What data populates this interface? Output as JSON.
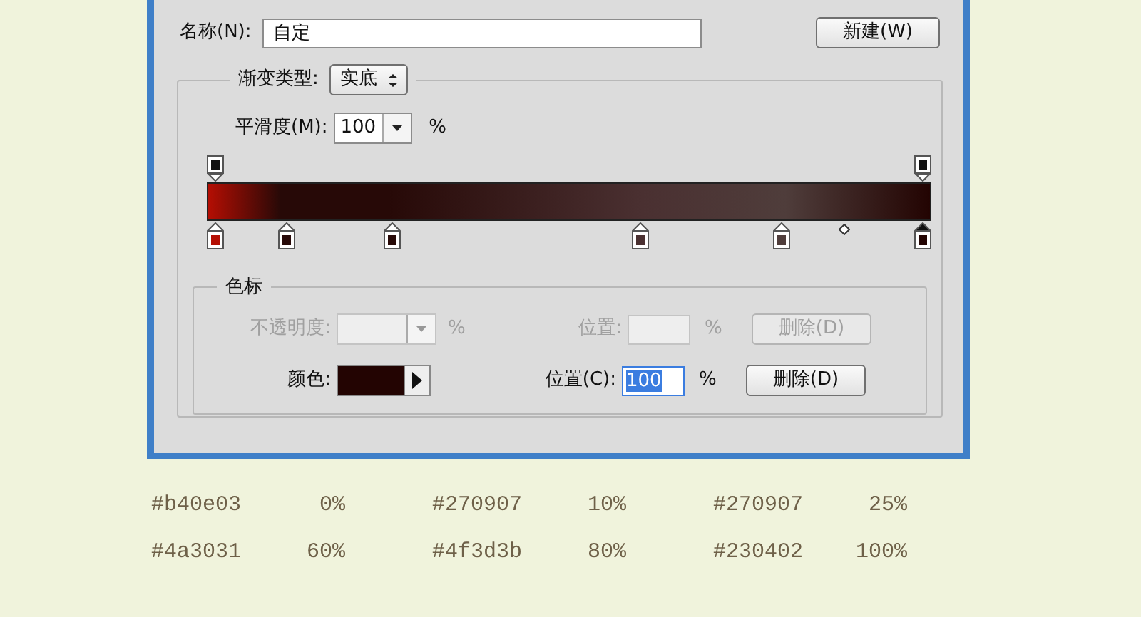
{
  "name_field": {
    "label": "名称(N):",
    "value": "自定"
  },
  "new_button": {
    "label": "新建(W)"
  },
  "gradient_type": {
    "label": "渐变类型:",
    "value": "实底"
  },
  "smoothness": {
    "label": "平滑度(M):",
    "value": "100",
    "unit": "%"
  },
  "opacity_stops": [
    {
      "level": 0,
      "selected": false
    },
    {
      "level": 1,
      "selected": false
    }
  ],
  "color_stops": [
    {
      "color": "#b40e03",
      "level": 0,
      "selected": false
    },
    {
      "color": "#270907",
      "level": 0.1,
      "selected": false
    },
    {
      "color": "#270907",
      "level": 0.25,
      "selected": false
    },
    {
      "color": "#4a3031",
      "level": 0.6,
      "selected": false
    },
    {
      "color": "#4f3d3b",
      "level": 0.8,
      "selected": false
    },
    {
      "color": "#230402",
      "level": 1,
      "selected": true
    }
  ],
  "midpoint": {
    "level": 0.89
  },
  "stops_group": {
    "title": "色标",
    "opacity": {
      "label": "不透明度:",
      "unit": "%",
      "disabled": true
    },
    "opacity_location": {
      "label": "位置:",
      "unit": "%",
      "disabled": true
    },
    "opacity_delete": {
      "label": "删除(D)",
      "disabled": true
    },
    "color": {
      "label": "颜色:",
      "color": "#230402"
    },
    "color_location": {
      "label": "位置(C):",
      "value": "100",
      "unit": "%",
      "highlighted": true
    },
    "color_delete": {
      "label": "删除(D)",
      "disabled": false
    }
  },
  "swatch_list": [
    {
      "hex": "#b40e03",
      "percent": "0%"
    },
    {
      "hex": "#270907",
      "percent": "10%"
    },
    {
      "hex": "#270907",
      "percent": "25%"
    },
    {
      "hex": "#4a3031",
      "percent": "60%"
    },
    {
      "hex": "#4f3d3b",
      "percent": "80%"
    },
    {
      "hex": "#230402",
      "percent": "100%"
    }
  ]
}
